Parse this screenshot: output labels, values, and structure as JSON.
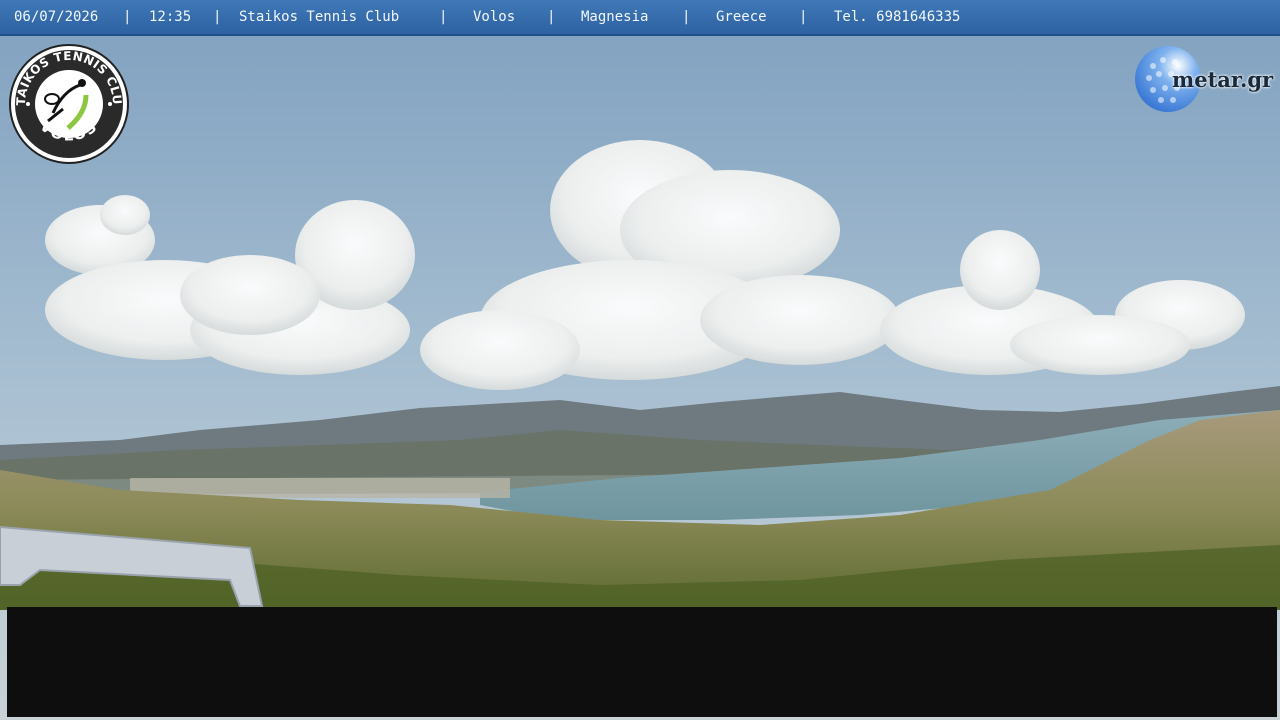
{
  "header": {
    "date": "06/07/2026",
    "time": "12:35",
    "club": "Staikos Tennis Club",
    "city": "Volos",
    "region": "Magnesia",
    "country": "Greece",
    "phone": "Tel. 6981646335",
    "separator": "|"
  },
  "logos": {
    "club_logo_text_top": "STAIKOS TENNIS CLUB",
    "club_logo_text_bottom": "VOLOS",
    "metar": "metar.gr"
  },
  "colors": {
    "header_bar": "#2e62a2",
    "sky": "#8fb0c8",
    "sea": "#7fa3ad"
  },
  "icons": [
    "tennis-player-icon",
    "golf-ball-icon"
  ]
}
